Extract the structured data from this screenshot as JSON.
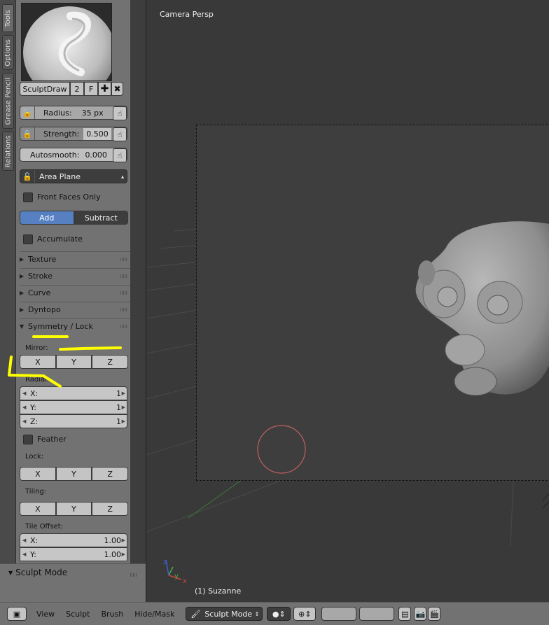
{
  "tabs": [
    "Tools",
    "Options",
    "Grease Pencil",
    "Relations"
  ],
  "brush": {
    "name": "SculptDraw",
    "users": "2",
    "fake_user": "F"
  },
  "fields": {
    "radius_label": "Radius:",
    "radius_value": "35 px",
    "strength_label": "Strength:",
    "strength_value": "0.500",
    "autosmooth_label": "Autosmooth:",
    "autosmooth_value": "0.000"
  },
  "area_plane": "Area Plane",
  "front_faces_only": "Front Faces Only",
  "direction": {
    "add": "Add",
    "subtract": "Subtract"
  },
  "accumulate": "Accumulate",
  "subpanels": [
    "Texture",
    "Stroke",
    "Curve",
    "Dyntopo"
  ],
  "symmetry": {
    "title": "Symmetry / Lock",
    "mirror_label": "Mirror:",
    "axes": [
      "X",
      "Y",
      "Z"
    ],
    "radial_label": "Radial:",
    "radial": [
      {
        "axis": "X:",
        "value": "1"
      },
      {
        "axis": "Y:",
        "value": "1"
      },
      {
        "axis": "Z:",
        "value": "1"
      }
    ],
    "feather": "Feather",
    "lock_label": "Lock:",
    "tiling_label": "Tiling:",
    "tile_offset_label": "Tile Offset:",
    "tile_offset": [
      {
        "axis": "X:",
        "value": "1.00"
      },
      {
        "axis": "Y:",
        "value": "1.00"
      }
    ]
  },
  "mode_panel_title": "Sculpt Mode",
  "viewport": {
    "camera_label": "Camera Persp",
    "object_label": "(1) Suzanne",
    "axis_x": "x",
    "axis_y": "y",
    "axis_z": "z"
  },
  "header": {
    "menus": [
      "View",
      "Sculpt",
      "Brush",
      "Hide/Mask"
    ],
    "mode": "Sculpt Mode"
  },
  "colors": {
    "annotation": "#ffff00",
    "brush_cursor": "#c06060",
    "add_active": "#5680c2"
  }
}
